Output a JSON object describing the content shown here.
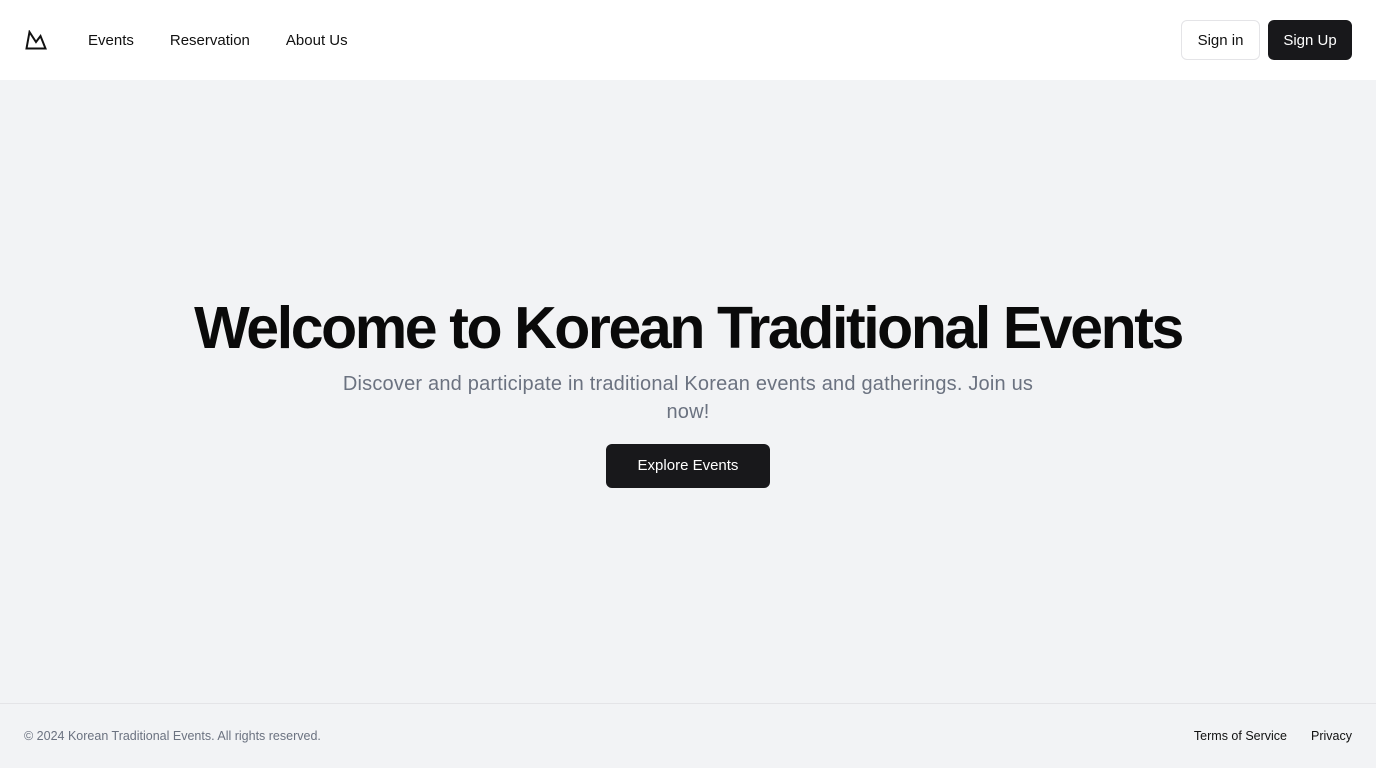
{
  "header": {
    "logo_icon": "mountain-icon",
    "nav": [
      {
        "label": "Events"
      },
      {
        "label": "Reservation"
      },
      {
        "label": "About Us"
      }
    ],
    "sign_in_label": "Sign in",
    "sign_up_label": "Sign Up"
  },
  "hero": {
    "title": "Welcome to Korean Traditional Events",
    "subtitle": "Discover and participate in traditional Korean events and gatherings. Join us now!",
    "cta_label": "Explore Events"
  },
  "footer": {
    "copyright": "© 2024 Korean Traditional Events. All rights reserved.",
    "links": [
      {
        "label": "Terms of Service"
      },
      {
        "label": "Privacy"
      }
    ]
  },
  "colors": {
    "background": "#f2f3f5",
    "header_bg": "#ffffff",
    "primary_dark": "#18181b",
    "muted_text": "#6b7280"
  }
}
